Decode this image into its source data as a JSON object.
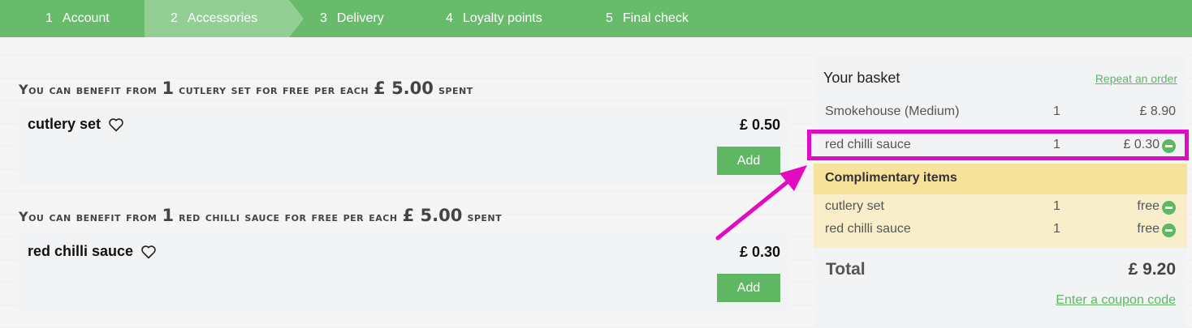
{
  "steps": [
    {
      "num": "1",
      "label": "Account"
    },
    {
      "num": "2",
      "label": "Accessories"
    },
    {
      "num": "3",
      "label": "Delivery"
    },
    {
      "num": "4",
      "label": "Loyalty points"
    },
    {
      "num": "5",
      "label": "Final check"
    }
  ],
  "offers": [
    {
      "heading_prefix": "You can benefit from",
      "count": "1",
      "item": "cutlery set",
      "heading_mid": "for free per each",
      "threshold": "£ 5.00",
      "heading_suffix": "spent",
      "product_name": "cutlery set",
      "price": "£ 0.50",
      "add_label": "Add"
    },
    {
      "heading_prefix": "You can benefit from",
      "count": "1",
      "item": "red chilli sauce",
      "heading_mid": "for free per each",
      "threshold": "£ 5.00",
      "heading_suffix": "spent",
      "product_name": "red chilli sauce",
      "price": "£ 0.30",
      "add_label": "Add"
    }
  ],
  "basket": {
    "title": "Your basket",
    "repeat_label": "Repeat an order",
    "items": [
      {
        "name": "Smokehouse (Medium)",
        "qty": "1",
        "price": "£ 8.90"
      },
      {
        "name": "red chilli sauce",
        "qty": "1",
        "price": "£ 0.30"
      }
    ],
    "complimentary_title": "Complimentary items",
    "complimentary": [
      {
        "name": "cutlery set",
        "qty": "1",
        "price": "free"
      },
      {
        "name": "red chilli sauce",
        "qty": "1",
        "price": "free"
      }
    ],
    "total_label": "Total",
    "total_value": "£ 9.20",
    "coupon_label": "Enter a coupon code"
  },
  "colors": {
    "brand_green": "#67bb6a",
    "active_step": "#93cf95",
    "highlight": "#e10cc1",
    "complimentary_header": "#f7e29c"
  },
  "icons": [
    "heart-icon",
    "remove-icon",
    "arrow-annotation"
  ]
}
